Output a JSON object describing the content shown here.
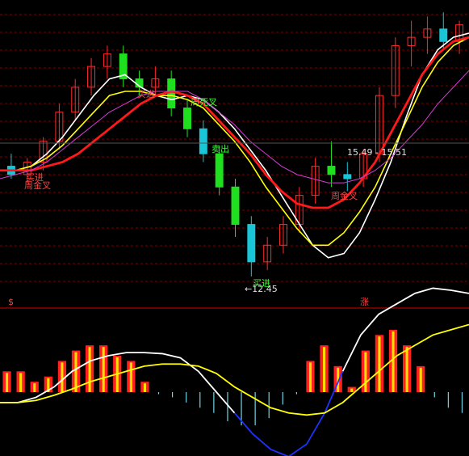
{
  "colors": {
    "bg": "#000000",
    "grid": "#7a0000",
    "divider": "#b00000",
    "candle_up": "#ff2a2a",
    "candle_down_main": "#1fe01f",
    "candle_down_alt": "#19c6d8",
    "ma_white": "#ffffff",
    "ma_yellow": "#ffff00",
    "ma_red": "#ff1a1a",
    "ma_magenta": "#d23cd2",
    "label_red": "#ff4040",
    "label_green": "#39ff39",
    "macd_up_fill": "#ff2020",
    "macd_up_inner": "#ffe000",
    "macd_down": "#6fd6e6",
    "dif_white": "#ffffff",
    "dea_yellow": "#ffff00",
    "dif_blue": "#1e32ff"
  },
  "annotations": {
    "buy_left": "买进",
    "cross_left": "周金叉",
    "buy_mid": "买进",
    "death_mid": "周死叉",
    "sell_mid": "卖出",
    "buy_low": "买进",
    "cross_right": "周金叉",
    "low_price": "←12.45",
    "high_range": "15.49 - 15.51",
    "panel_left_tag": "$",
    "panel_right_tag": "涨"
  },
  "chart_data": [
    {
      "type": "candlestick",
      "title": "",
      "series": [
        {
          "name": "white_ma",
          "values": [
            15.0,
            15.0,
            15.1,
            15.4,
            15.8,
            16.3,
            16.8,
            17.2,
            17.3,
            17.0,
            16.8,
            16.7,
            16.8,
            16.7,
            16.4,
            16.0,
            15.5,
            15.0,
            14.4,
            13.8,
            13.2,
            12.9,
            13.0,
            13.5,
            14.3,
            15.2,
            16.3,
            17.3,
            17.9,
            18.2,
            18.3
          ]
        },
        {
          "name": "yellow_ma",
          "values": [
            15.0,
            15.0,
            15.1,
            15.3,
            15.6,
            16.0,
            16.4,
            16.8,
            16.9,
            16.9,
            16.8,
            16.8,
            16.7,
            16.5,
            16.1,
            15.7,
            15.2,
            14.6,
            14.1,
            13.6,
            13.2,
            13.2,
            13.5,
            14.0,
            14.6,
            15.4,
            16.2,
            17.0,
            17.6,
            18.0,
            18.2
          ]
        },
        {
          "name": "red_ma",
          "values": [
            15.0,
            15.0,
            15.0,
            15.1,
            15.2,
            15.4,
            15.7,
            16.0,
            16.3,
            16.6,
            16.8,
            16.9,
            16.8,
            16.6,
            16.2,
            15.8,
            15.4,
            14.9,
            14.5,
            14.2,
            14.1,
            14.1,
            14.3,
            14.7,
            15.2,
            15.9,
            16.6,
            17.3,
            17.8,
            18.1,
            18.2
          ]
        },
        {
          "name": "magenta_ma",
          "values": [
            14.8,
            14.9,
            15.0,
            15.2,
            15.5,
            15.8,
            16.1,
            16.4,
            16.6,
            16.8,
            16.9,
            16.9,
            16.9,
            16.7,
            16.4,
            16.1,
            15.7,
            15.4,
            15.1,
            14.9,
            14.8,
            14.7,
            14.7,
            14.8,
            15.0,
            15.3,
            15.7,
            16.1,
            16.6,
            17.0,
            17.4
          ]
        }
      ],
      "candles": [
        {
          "o": 15.1,
          "h": 15.4,
          "l": 14.8,
          "c": 14.9
        },
        {
          "o": 14.9,
          "h": 15.3,
          "l": 14.7,
          "c": 15.2
        },
        {
          "o": 15.2,
          "h": 15.8,
          "l": 15.0,
          "c": 15.7
        },
        {
          "o": 15.7,
          "h": 16.6,
          "l": 15.5,
          "c": 16.4
        },
        {
          "o": 16.4,
          "h": 17.2,
          "l": 16.2,
          "c": 17.0
        },
        {
          "o": 17.0,
          "h": 17.7,
          "l": 16.8,
          "c": 17.5
        },
        {
          "o": 17.5,
          "h": 18.0,
          "l": 17.2,
          "c": 17.8
        },
        {
          "o": 17.8,
          "h": 18.0,
          "l": 17.0,
          "c": 17.2
        },
        {
          "o": 17.2,
          "h": 17.4,
          "l": 16.8,
          "c": 17.0
        },
        {
          "o": 17.0,
          "h": 17.5,
          "l": 16.8,
          "c": 17.2
        },
        {
          "o": 17.2,
          "h": 17.4,
          "l": 16.3,
          "c": 16.5
        },
        {
          "o": 16.5,
          "h": 16.7,
          "l": 15.8,
          "c": 16.0
        },
        {
          "o": 16.0,
          "h": 16.2,
          "l": 15.2,
          "c": 15.4
        },
        {
          "o": 15.4,
          "h": 15.6,
          "l": 14.4,
          "c": 14.6
        },
        {
          "o": 14.6,
          "h": 14.8,
          "l": 13.4,
          "c": 13.7
        },
        {
          "o": 13.7,
          "h": 13.9,
          "l": 12.45,
          "c": 12.8
        },
        {
          "o": 12.8,
          "h": 13.4,
          "l": 12.6,
          "c": 13.2
        },
        {
          "o": 13.2,
          "h": 13.9,
          "l": 13.0,
          "c": 13.7
        },
        {
          "o": 13.7,
          "h": 14.6,
          "l": 13.5,
          "c": 14.4
        },
        {
          "o": 14.4,
          "h": 15.3,
          "l": 14.2,
          "c": 15.1
        },
        {
          "o": 15.1,
          "h": 15.7,
          "l": 14.6,
          "c": 14.9
        },
        {
          "o": 14.9,
          "h": 15.2,
          "l": 14.5,
          "c": 14.8
        },
        {
          "o": 14.8,
          "h": 15.51,
          "l": 14.6,
          "c": 15.4
        },
        {
          "o": 15.4,
          "h": 17.0,
          "l": 15.2,
          "c": 16.8
        },
        {
          "o": 16.8,
          "h": 18.2,
          "l": 16.5,
          "c": 18.0
        },
        {
          "o": 18.0,
          "h": 18.6,
          "l": 17.5,
          "c": 18.2
        },
        {
          "o": 18.2,
          "h": 18.7,
          "l": 17.8,
          "c": 18.4
        },
        {
          "o": 18.4,
          "h": 18.8,
          "l": 17.9,
          "c": 18.1
        },
        {
          "o": 18.1,
          "h": 18.6,
          "l": 17.8,
          "c": 18.5
        }
      ],
      "low_marker": 12.45,
      "grid": true
    },
    {
      "type": "bar",
      "title": "",
      "values": [
        0.2,
        0.2,
        0.1,
        0.15,
        0.3,
        0.4,
        0.45,
        0.45,
        0.35,
        0.3,
        0.1,
        -0.02,
        -0.05,
        -0.1,
        -0.15,
        -0.2,
        -0.28,
        -0.32,
        -0.32,
        -0.25,
        -0.12,
        -0.02,
        0.3,
        0.45,
        0.25,
        0.05,
        0.4,
        0.55,
        0.6,
        0.45,
        0.25,
        -0.05,
        -0.15,
        -0.2
      ],
      "series": [
        {
          "name": "dif",
          "values": [
            -0.1,
            -0.1,
            -0.05,
            0.05,
            0.2,
            0.3,
            0.35,
            0.38,
            0.38,
            0.37,
            0.33,
            0.2,
            0.0,
            -0.2,
            -0.4,
            -0.55,
            -0.62,
            -0.5,
            -0.2,
            0.2,
            0.55,
            0.75,
            0.85,
            0.95,
            1.0,
            0.98,
            0.95
          ]
        },
        {
          "name": "dea",
          "values": [
            -0.1,
            -0.1,
            -0.08,
            -0.03,
            0.03,
            0.1,
            0.15,
            0.2,
            0.25,
            0.27,
            0.27,
            0.25,
            0.18,
            0.05,
            -0.05,
            -0.15,
            -0.2,
            -0.22,
            -0.2,
            -0.1,
            0.05,
            0.2,
            0.35,
            0.45,
            0.55,
            0.6,
            0.65
          ]
        }
      ],
      "grid": false
    }
  ]
}
